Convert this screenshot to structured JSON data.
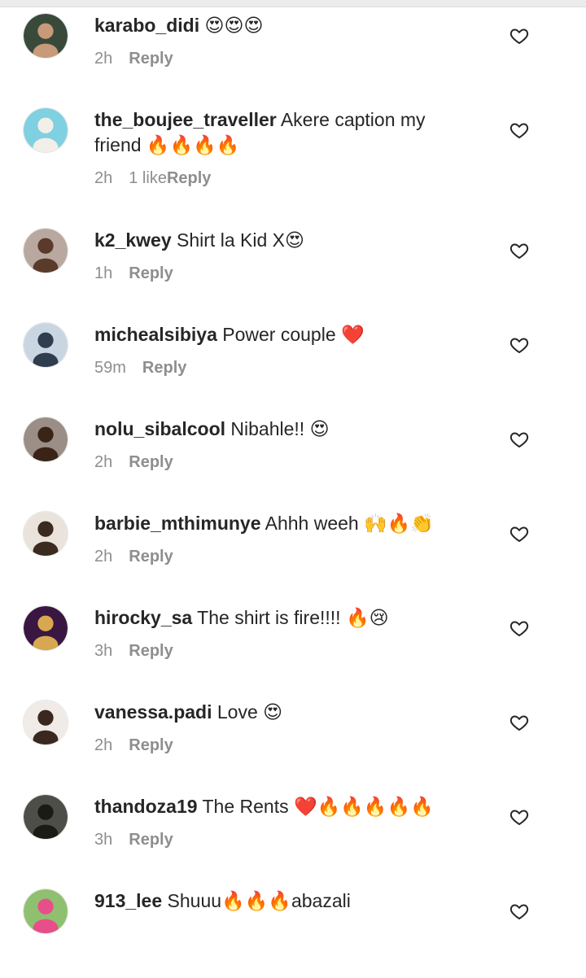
{
  "comments": [
    {
      "username": "karabo_didi",
      "text": " 😍😍😍",
      "time": "2h",
      "likes": "",
      "reply": "Reply",
      "avatar_bg": "#3a4a3a",
      "avatar_fg": "#c79a7a"
    },
    {
      "username": "the_boujee_traveller",
      "text": " Akere caption my friend 🔥🔥🔥🔥",
      "time": "2h",
      "likes": "1 like",
      "reply": "Reply",
      "avatar_bg": "#7fd0e0",
      "avatar_fg": "#f2efe8"
    },
    {
      "username": "k2_kwey",
      "text": " Shirt la Kid X😍",
      "time": "1h",
      "likes": "",
      "reply": "Reply",
      "avatar_bg": "#b8a8a0",
      "avatar_fg": "#5a3a2a"
    },
    {
      "username": "michealsibiya",
      "text": " Power couple ❤️",
      "time": "59m",
      "likes": "",
      "reply": "Reply",
      "avatar_bg": "#c9d6e2",
      "avatar_fg": "#2f3d4e"
    },
    {
      "username": "nolu_sibalcool",
      "text": " Nibahle!! 😍",
      "time": "2h",
      "likes": "",
      "reply": "Reply",
      "avatar_bg": "#9a8e86",
      "avatar_fg": "#3a2418"
    },
    {
      "username": "barbie_mthimunye",
      "text": " Ahhh weeh 🙌🔥👏",
      "time": "2h",
      "likes": "",
      "reply": "Reply",
      "avatar_bg": "#e9e3dc",
      "avatar_fg": "#3b2a20"
    },
    {
      "username": "hirocky_sa",
      "text": " The shirt is fire!!!! 🔥😢",
      "time": "3h",
      "likes": "",
      "reply": "Reply",
      "avatar_bg": "#3a1642",
      "avatar_fg": "#d8a850"
    },
    {
      "username": "vanessa.padi",
      "text": " Love 😍",
      "time": "2h",
      "likes": "",
      "reply": "Reply",
      "avatar_bg": "#f0ebe6",
      "avatar_fg": "#3a2820"
    },
    {
      "username": "thandoza19",
      "text": " The Rents ❤️🔥🔥🔥🔥🔥",
      "time": "3h",
      "likes": "",
      "reply": "Reply",
      "avatar_bg": "#4e4e48",
      "avatar_fg": "#1a1a16"
    },
    {
      "username": "913_lee",
      "text": " Shuuu🔥🔥🔥abazali",
      "time": "",
      "likes": "",
      "reply": "",
      "avatar_bg": "#8fc070",
      "avatar_fg": "#e84e8a"
    }
  ]
}
